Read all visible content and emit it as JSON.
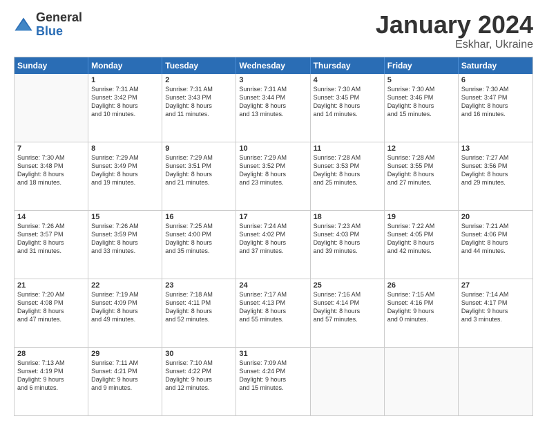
{
  "logo": {
    "general": "General",
    "blue": "Blue"
  },
  "title": {
    "month": "January 2024",
    "location": "Eskhar, Ukraine"
  },
  "header": {
    "days": [
      "Sunday",
      "Monday",
      "Tuesday",
      "Wednesday",
      "Thursday",
      "Friday",
      "Saturday"
    ]
  },
  "weeks": [
    [
      {
        "day": "",
        "empty": true
      },
      {
        "day": "1",
        "lines": [
          "Sunrise: 7:31 AM",
          "Sunset: 3:42 PM",
          "Daylight: 8 hours",
          "and 10 minutes."
        ]
      },
      {
        "day": "2",
        "lines": [
          "Sunrise: 7:31 AM",
          "Sunset: 3:43 PM",
          "Daylight: 8 hours",
          "and 11 minutes."
        ]
      },
      {
        "day": "3",
        "lines": [
          "Sunrise: 7:31 AM",
          "Sunset: 3:44 PM",
          "Daylight: 8 hours",
          "and 13 minutes."
        ]
      },
      {
        "day": "4",
        "lines": [
          "Sunrise: 7:30 AM",
          "Sunset: 3:45 PM",
          "Daylight: 8 hours",
          "and 14 minutes."
        ]
      },
      {
        "day": "5",
        "lines": [
          "Sunrise: 7:30 AM",
          "Sunset: 3:46 PM",
          "Daylight: 8 hours",
          "and 15 minutes."
        ]
      },
      {
        "day": "6",
        "lines": [
          "Sunrise: 7:30 AM",
          "Sunset: 3:47 PM",
          "Daylight: 8 hours",
          "and 16 minutes."
        ]
      }
    ],
    [
      {
        "day": "7",
        "lines": [
          "Sunrise: 7:30 AM",
          "Sunset: 3:48 PM",
          "Daylight: 8 hours",
          "and 18 minutes."
        ]
      },
      {
        "day": "8",
        "lines": [
          "Sunrise: 7:29 AM",
          "Sunset: 3:49 PM",
          "Daylight: 8 hours",
          "and 19 minutes."
        ]
      },
      {
        "day": "9",
        "lines": [
          "Sunrise: 7:29 AM",
          "Sunset: 3:51 PM",
          "Daylight: 8 hours",
          "and 21 minutes."
        ]
      },
      {
        "day": "10",
        "lines": [
          "Sunrise: 7:29 AM",
          "Sunset: 3:52 PM",
          "Daylight: 8 hours",
          "and 23 minutes."
        ]
      },
      {
        "day": "11",
        "lines": [
          "Sunrise: 7:28 AM",
          "Sunset: 3:53 PM",
          "Daylight: 8 hours",
          "and 25 minutes."
        ]
      },
      {
        "day": "12",
        "lines": [
          "Sunrise: 7:28 AM",
          "Sunset: 3:55 PM",
          "Daylight: 8 hours",
          "and 27 minutes."
        ]
      },
      {
        "day": "13",
        "lines": [
          "Sunrise: 7:27 AM",
          "Sunset: 3:56 PM",
          "Daylight: 8 hours",
          "and 29 minutes."
        ]
      }
    ],
    [
      {
        "day": "14",
        "lines": [
          "Sunrise: 7:26 AM",
          "Sunset: 3:57 PM",
          "Daylight: 8 hours",
          "and 31 minutes."
        ]
      },
      {
        "day": "15",
        "lines": [
          "Sunrise: 7:26 AM",
          "Sunset: 3:59 PM",
          "Daylight: 8 hours",
          "and 33 minutes."
        ]
      },
      {
        "day": "16",
        "lines": [
          "Sunrise: 7:25 AM",
          "Sunset: 4:00 PM",
          "Daylight: 8 hours",
          "and 35 minutes."
        ]
      },
      {
        "day": "17",
        "lines": [
          "Sunrise: 7:24 AM",
          "Sunset: 4:02 PM",
          "Daylight: 8 hours",
          "and 37 minutes."
        ]
      },
      {
        "day": "18",
        "lines": [
          "Sunrise: 7:23 AM",
          "Sunset: 4:03 PM",
          "Daylight: 8 hours",
          "and 39 minutes."
        ]
      },
      {
        "day": "19",
        "lines": [
          "Sunrise: 7:22 AM",
          "Sunset: 4:05 PM",
          "Daylight: 8 hours",
          "and 42 minutes."
        ]
      },
      {
        "day": "20",
        "lines": [
          "Sunrise: 7:21 AM",
          "Sunset: 4:06 PM",
          "Daylight: 8 hours",
          "and 44 minutes."
        ]
      }
    ],
    [
      {
        "day": "21",
        "lines": [
          "Sunrise: 7:20 AM",
          "Sunset: 4:08 PM",
          "Daylight: 8 hours",
          "and 47 minutes."
        ]
      },
      {
        "day": "22",
        "lines": [
          "Sunrise: 7:19 AM",
          "Sunset: 4:09 PM",
          "Daylight: 8 hours",
          "and 49 minutes."
        ]
      },
      {
        "day": "23",
        "lines": [
          "Sunrise: 7:18 AM",
          "Sunset: 4:11 PM",
          "Daylight: 8 hours",
          "and 52 minutes."
        ]
      },
      {
        "day": "24",
        "lines": [
          "Sunrise: 7:17 AM",
          "Sunset: 4:13 PM",
          "Daylight: 8 hours",
          "and 55 minutes."
        ]
      },
      {
        "day": "25",
        "lines": [
          "Sunrise: 7:16 AM",
          "Sunset: 4:14 PM",
          "Daylight: 8 hours",
          "and 57 minutes."
        ]
      },
      {
        "day": "26",
        "lines": [
          "Sunrise: 7:15 AM",
          "Sunset: 4:16 PM",
          "Daylight: 9 hours",
          "and 0 minutes."
        ]
      },
      {
        "day": "27",
        "lines": [
          "Sunrise: 7:14 AM",
          "Sunset: 4:17 PM",
          "Daylight: 9 hours",
          "and 3 minutes."
        ]
      }
    ],
    [
      {
        "day": "28",
        "lines": [
          "Sunrise: 7:13 AM",
          "Sunset: 4:19 PM",
          "Daylight: 9 hours",
          "and 6 minutes."
        ]
      },
      {
        "day": "29",
        "lines": [
          "Sunrise: 7:11 AM",
          "Sunset: 4:21 PM",
          "Daylight: 9 hours",
          "and 9 minutes."
        ]
      },
      {
        "day": "30",
        "lines": [
          "Sunrise: 7:10 AM",
          "Sunset: 4:22 PM",
          "Daylight: 9 hours",
          "and 12 minutes."
        ]
      },
      {
        "day": "31",
        "lines": [
          "Sunrise: 7:09 AM",
          "Sunset: 4:24 PM",
          "Daylight: 9 hours",
          "and 15 minutes."
        ]
      },
      {
        "day": "",
        "empty": true
      },
      {
        "day": "",
        "empty": true
      },
      {
        "day": "",
        "empty": true
      }
    ]
  ]
}
